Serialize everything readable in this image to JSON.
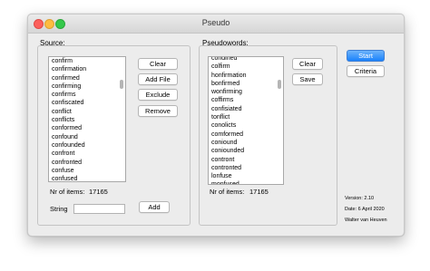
{
  "window": {
    "title": "Pseudo"
  },
  "source": {
    "label": "Source:",
    "items": [
      "confirm",
      "confirmation",
      "confirmed",
      "confirming",
      "confirms",
      "confiscated",
      "conflict",
      "conflicts",
      "conformed",
      "confound",
      "confounded",
      "confront",
      "confronted",
      "confuse",
      "confused"
    ],
    "buttons": {
      "clear": "Clear",
      "add_file": "Add File",
      "exclude": "Exclude",
      "remove": "Remove"
    },
    "nr_label": "Nr of items:",
    "nr_value": "17165",
    "string_label": "String",
    "string_value": "",
    "add_label": "Add"
  },
  "pseudo": {
    "label": "Pseudowords:",
    "items": [
      "condined",
      "colfirm",
      "honfirmation",
      "bonfirmed",
      "wonfirming",
      "coffirms",
      "confisiated",
      "tonflict",
      "conolicts",
      "comformed",
      "coniound",
      "coniounded",
      "contront",
      "contronted",
      "lonfuse",
      "monfused"
    ],
    "buttons": {
      "clear": "Clear",
      "save": "Save"
    },
    "nr_label": "Nr of items:",
    "nr_value": "17165"
  },
  "actions": {
    "start": "Start",
    "criteria": "Criteria"
  },
  "info": {
    "version": "Version: 2.10",
    "date": "Date: 6 April 2020",
    "author": "Walter van Heuven"
  },
  "colors": {
    "accent": "#1a82fb",
    "window_bg": "#ececec"
  }
}
